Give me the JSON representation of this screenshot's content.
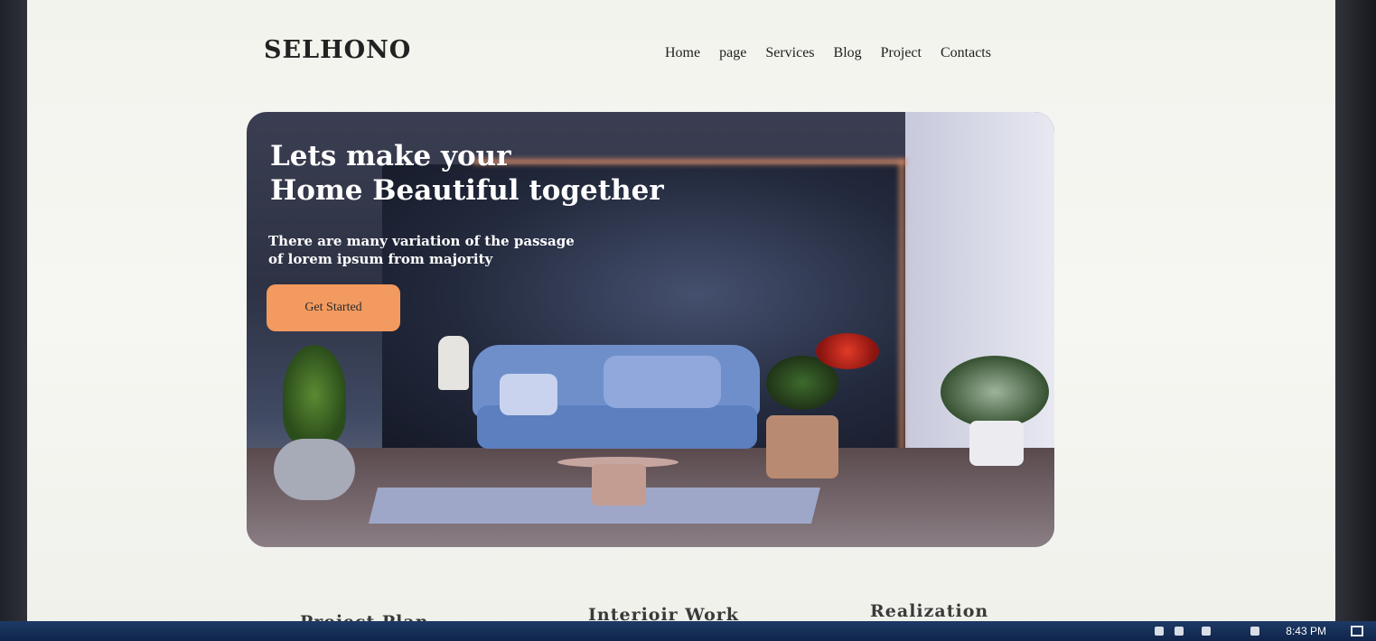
{
  "brand": {
    "name": "SELHONO"
  },
  "nav": {
    "items": [
      "Home",
      "page",
      "Services",
      "Blog",
      "Project",
      "Contacts"
    ]
  },
  "hero": {
    "title_line1": "Lets make your",
    "title_line2": "Home Beautiful together",
    "subtitle": "There are many variation of the passage of lorem ipsum from majority",
    "cta_label": "Get Started",
    "accent_color": "#f29a5f"
  },
  "features": [
    "Project Plan",
    "Interioir Work",
    "Realization"
  ],
  "taskbar": {
    "clock": "8:43 PM"
  }
}
